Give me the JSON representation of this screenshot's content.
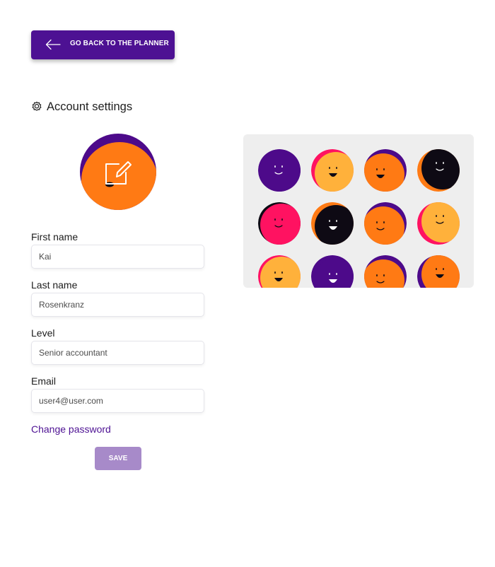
{
  "back_button": {
    "label": "GO BACK TO THE PLANNER",
    "icon": "arrow-left-icon"
  },
  "section": {
    "title": "Account settings",
    "icon": "gear-icon"
  },
  "avatar": {
    "icon": "edit-icon",
    "colors": [
      "#4d0a8a",
      "#ff7a14"
    ]
  },
  "form": {
    "first_name": {
      "label": "First name",
      "value": "Kai"
    },
    "last_name": {
      "label": "Last name",
      "value": "Rosenkranz"
    },
    "level": {
      "label": "Level",
      "value": "Senior accountant"
    },
    "email": {
      "label": "Email",
      "value": "user4@user.com"
    }
  },
  "change_password": "Change password",
  "save_label": "SAVE",
  "colors": {
    "brand_purple": "#4d1193",
    "save_disabled": "#a78ac9",
    "orange": "#ff7a14",
    "pink": "#ff1261",
    "yellow": "#ffb13b",
    "black": "#0e0a14",
    "picker_bg": "#eeeeee"
  },
  "avatar_options": [
    {
      "bg": "#4d0a8a",
      "fg": "#4d0a8a",
      "mouth": "smile"
    },
    {
      "bg": "#ff1261",
      "fg": "#ffb13b",
      "mouth": "open"
    },
    {
      "bg": "#4d0a8a",
      "fg": "#ff7a14",
      "mouth": "open"
    },
    {
      "bg": "#ff7a14",
      "fg": "#0e0a14",
      "mouth": "smile"
    },
    {
      "bg": "#0e0a14",
      "fg": "#ff1261",
      "mouth": "smile"
    },
    {
      "bg": "#ff7a14",
      "fg": "#0e0a14",
      "mouth": "open"
    },
    {
      "bg": "#4d0a8a",
      "fg": "#ff7a14",
      "mouth": "smile"
    },
    {
      "bg": "#ff1261",
      "fg": "#ffb13b",
      "mouth": "smile"
    },
    {
      "bg": "#ff1261",
      "fg": "#ffb13b",
      "mouth": "open"
    },
    {
      "bg": "#4d0a8a",
      "fg": "#4d0a8a",
      "mouth": "open"
    },
    {
      "bg": "#4d0a8a",
      "fg": "#ff7a14",
      "mouth": "smile"
    },
    {
      "bg": "#4d0a8a",
      "fg": "#ff7a14",
      "mouth": "open"
    }
  ]
}
